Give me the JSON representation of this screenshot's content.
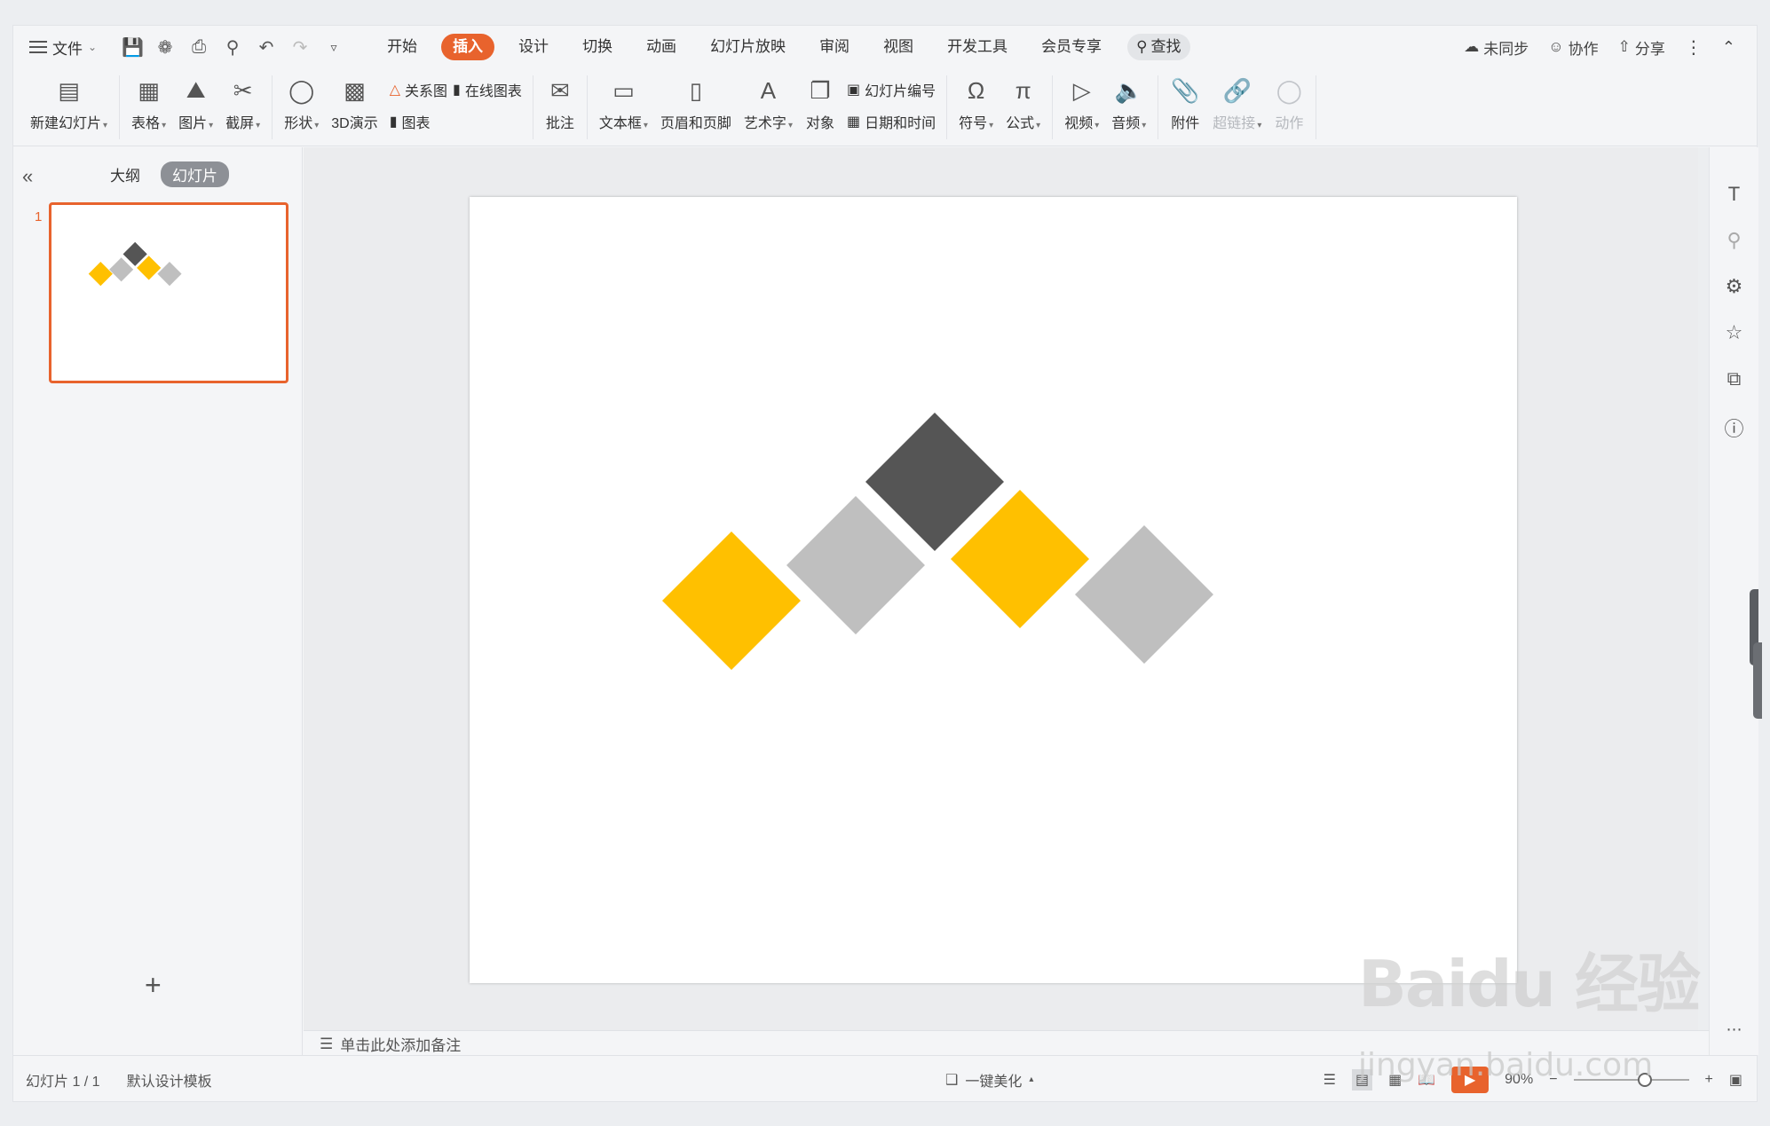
{
  "menubar": {
    "file_label": "文件",
    "tabs": [
      {
        "label": "开始"
      },
      {
        "label": "插入"
      },
      {
        "label": "设计"
      },
      {
        "label": "切换"
      },
      {
        "label": "动画"
      },
      {
        "label": "幻灯片放映"
      },
      {
        "label": "审阅"
      },
      {
        "label": "视图"
      },
      {
        "label": "开发工具"
      },
      {
        "label": "会员专享"
      }
    ],
    "active_tab": "插入",
    "search_label": "查找",
    "right": {
      "sync": "未同步",
      "collab": "协作",
      "share": "分享"
    }
  },
  "ribbon": {
    "new_slide": "新建幻灯片",
    "table": "表格",
    "picture": "图片",
    "screenshot": "截屏",
    "shape": "形状",
    "demo3d": "3D演示",
    "relation": "关系图",
    "online_chart": "在线图表",
    "chart": "图表",
    "comment": "批注",
    "textbox": "文本框",
    "header_footer": "页眉和页脚",
    "wordart": "艺术字",
    "object": "对象",
    "slide_number": "幻灯片编号",
    "date_time": "日期和时间",
    "symbol": "符号",
    "formula": "公式",
    "video": "视频",
    "audio": "音频",
    "attachment": "附件",
    "hyperlink": "超链接",
    "action": "动作"
  },
  "leftpanel": {
    "outline_tab": "大纲",
    "slides_tab": "幻灯片",
    "slide_index": "1"
  },
  "notes": {
    "placeholder": "单击此处添加备注"
  },
  "statusbar": {
    "slide_info": "幻灯片 1 / 1",
    "template": "默认设计模板",
    "beautify": "一键美化",
    "zoom": "90%"
  },
  "slide": {
    "shapes": [
      {
        "kind": "diamond",
        "color": "#FFC000"
      },
      {
        "kind": "diamond",
        "color": "#BFBFBF"
      },
      {
        "kind": "diamond",
        "color": "#555555"
      },
      {
        "kind": "diamond",
        "color": "#FFC000"
      },
      {
        "kind": "diamond",
        "color": "#BFBFBF"
      }
    ]
  },
  "colors": {
    "accent": "#E8632D",
    "yellow": "#FFC000",
    "gray_light": "#BFBFBF",
    "gray_dark": "#555555"
  },
  "watermark": {
    "text": "Bai du 经验",
    "url": "jingyan.baidu.com"
  }
}
